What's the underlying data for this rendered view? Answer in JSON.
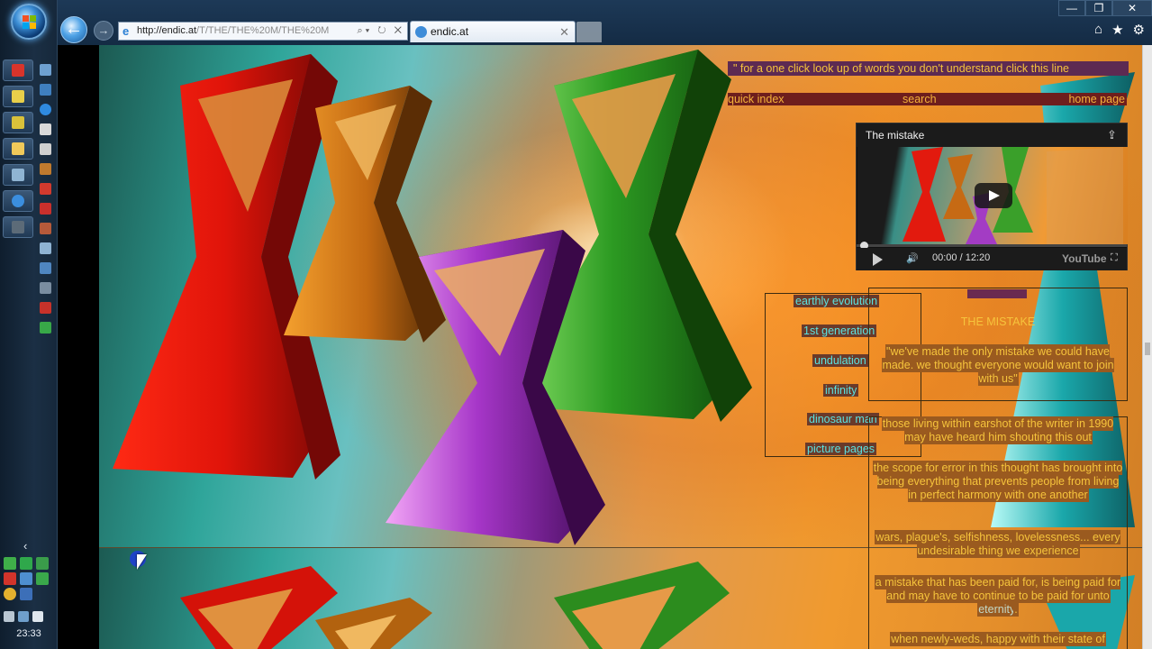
{
  "taskbar": {
    "clock": "23:33"
  },
  "browser": {
    "url_host": "http://endic.at",
    "url_path": "/T/THE/THE%20M/THE%20M",
    "address_controls": "⌕▾ ↻ ✕",
    "tab_title": "endic.at",
    "window_controls": {
      "minimize": "—",
      "restore": "❐",
      "close": "✕"
    },
    "command_icons": {
      "home": "⌂",
      "favorites": "★",
      "tools": "⚙"
    }
  },
  "page": {
    "lookup_line": "\" for a one click look up of words you don't understand click this line",
    "nav": {
      "quick_index": "quick index",
      "search": "search",
      "home_page": "home page"
    },
    "video": {
      "title": "The mistake",
      "time": "00:00 / 12:20",
      "brand": "YouTube"
    },
    "toc": [
      "earthly evolution",
      "1st generation",
      "undulation",
      "infinity",
      "dinosaur man",
      "picture pages"
    ],
    "story": {
      "title": "THE MISTAKE",
      "paragraphs": [
        "\"we've made the only mistake we could have made. we thought everyone would want to join with us\"",
        "those living within earshot of the writer in 1990 may have heard him shouting this out",
        "the scope for error in this thought has brought into being everything that prevents people from living in perfect harmony with one another",
        "wars, plague's, selfishness, lovelessness... every undesirable thing we experience",
        "a mistake that has been paid for, is being paid for and may have to continue to be paid for unto",
        "when newly-weds, happy with their state of"
      ],
      "link_word": "eternity",
      "link_tail": "."
    }
  },
  "colors": {
    "overlay_text": "#f6c43c",
    "toc_text": "#5be1e0",
    "lookup_bg": "#5d2a52",
    "nav_bg": "#6e1e1d"
  }
}
